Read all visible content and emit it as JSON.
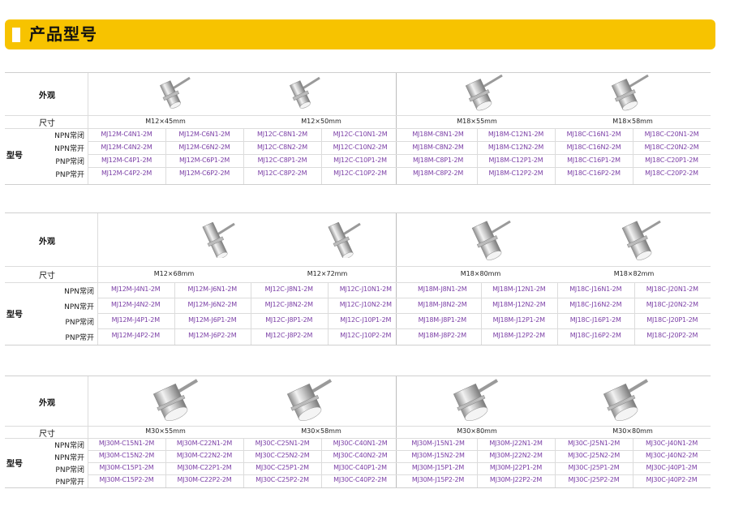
{
  "header": {
    "title": "产品型号"
  },
  "tables": [
    {
      "appearance_label": "外观",
      "size_label": "尺寸",
      "model_label": "型号",
      "types": [
        "NPN常闭",
        "NPN常开",
        "PNP常闭",
        "PNP常开"
      ],
      "sizes": [
        "M12×45mm",
        "M12×50mm",
        "M18×55mm",
        "M18×58mm"
      ],
      "models": [
        [
          "MJ12M-C4N1-2M",
          "MJ12M-C6N1-2M",
          "MJ12C-C8N1-2M",
          "MJ12C-C10N1-2M",
          "MJ18M-C8N1-2M",
          "MJ18M-C12N1-2M",
          "MJ18C-C16N1-2M",
          "MJ18C-C20N1-2M"
        ],
        [
          "MJ12M-C4N2-2M",
          "MJ12M-C6N2-2M",
          "MJ12C-C8N2-2M",
          "MJ12C-C10N2-2M",
          "MJ18M-C8N2-2M",
          "MJ18M-C12N2-2M",
          "MJ18C-C16N2-2M",
          "MJ18C-C20N2-2M"
        ],
        [
          "MJ12M-C4P1-2M",
          "MJ12M-C6P1-2M",
          "MJ12C-C8P1-2M",
          "MJ12C-C10P1-2M",
          "MJ18M-C8P1-2M",
          "MJ18M-C12P1-2M",
          "MJ18C-C16P1-2M",
          "MJ18C-C20P1-2M"
        ],
        [
          "MJ12M-C4P2-2M",
          "MJ12M-C6P2-2M",
          "MJ12C-C8P2-2M",
          "MJ12C-C10P2-2M",
          "MJ18M-C8P2-2M",
          "MJ18M-C12P2-2M",
          "MJ18C-C16P2-2M",
          "MJ18C-C20P2-2M"
        ]
      ]
    },
    {
      "appearance_label": "外观",
      "size_label": "尺寸",
      "model_label": "型号",
      "types": [
        "NPN常闭",
        "NPN常开",
        "PNP常闭",
        "PNP常开"
      ],
      "sizes": [
        "M12×68mm",
        "M12×72mm",
        "M18×80mm",
        "M18×82mm"
      ],
      "models": [
        [
          "MJ12M-J4N1-2M",
          "MJ12M-J6N1-2M",
          "MJ12C-J8N1-2M",
          "MJ12C-J10N1-2M",
          "MJ18M-J8N1-2M",
          "MJ18M-J12N1-2M",
          "MJ18C-J16N1-2M",
          "MJ18C-J20N1-2M"
        ],
        [
          "MJ12M-J4N2-2M",
          "MJ12M-J6N2-2M",
          "MJ12C-J8N2-2M",
          "MJ12C-J10N2-2M",
          "MJ18M-J8N2-2M",
          "MJ18M-J12N2-2M",
          "MJ18C-J16N2-2M",
          "MJ18C-J20N2-2M"
        ],
        [
          "MJ12M-J4P1-2M",
          "MJ12M-J6P1-2M",
          "MJ12C-J8P1-2M",
          "MJ12C-J10P1-2M",
          "MJ18M-J8P1-2M",
          "MJ18M-J12P1-2M",
          "MJ18C-J16P1-2M",
          "MJ18C-J20P1-2M"
        ],
        [
          "MJ12M-J4P2-2M",
          "MJ12M-J6P2-2M",
          "MJ12C-J8P2-2M",
          "MJ12C-J10P2-2M",
          "MJ18M-J8P2-2M",
          "MJ18M-J12P2-2M",
          "MJ18C-J16P2-2M",
          "MJ18C-J20P2-2M"
        ]
      ]
    },
    {
      "appearance_label": "外观",
      "size_label": "尺寸",
      "model_label": "型号",
      "types": [
        "NPN常闭",
        "NPN常开",
        "PNP常闭",
        "PNP常开"
      ],
      "sizes": [
        "M30×55mm",
        "M30×58mm",
        "M30×80mm",
        "M30×80mm"
      ],
      "models": [
        [
          "MJ30M-C15N1-2M",
          "MJ30M-C22N1-2M",
          "MJ30C-C25N1-2M",
          "MJ30C-C40N1-2M",
          "MJ30M-J15N1-2M",
          "MJ30M-J22N1-2M",
          "MJ30C-J25N1-2M",
          "MJ30C-J40N1-2M"
        ],
        [
          "MJ30M-C15N2-2M",
          "MJ30M-C22N2-2M",
          "MJ30C-C25N2-2M",
          "MJ30C-C40N2-2M",
          "MJ30M-J15N2-2M",
          "MJ30M-J22N2-2M",
          "MJ30C-J25N2-2M",
          "MJ30C-J40N2-2M"
        ],
        [
          "MJ30M-C15P1-2M",
          "MJ30M-C22P1-2M",
          "MJ30C-C25P1-2M",
          "MJ30C-C40P1-2M",
          "MJ30M-J15P1-2M",
          "MJ30M-J22P1-2M",
          "MJ30C-J25P1-2M",
          "MJ30C-J40P1-2M"
        ],
        [
          "MJ30M-C15P2-2M",
          "MJ30M-C22P2-2M",
          "MJ30C-C25P2-2M",
          "MJ30C-C40P2-2M",
          "MJ30M-J15P2-2M",
          "MJ30M-J22P2-2M",
          "MJ30C-J25P2-2M",
          "MJ30C-J40P2-2M"
        ]
      ]
    }
  ],
  "colors": {
    "header_bg": "#f7c300",
    "model_text": "#7b3fa6",
    "grid": "#dcdcdc"
  }
}
